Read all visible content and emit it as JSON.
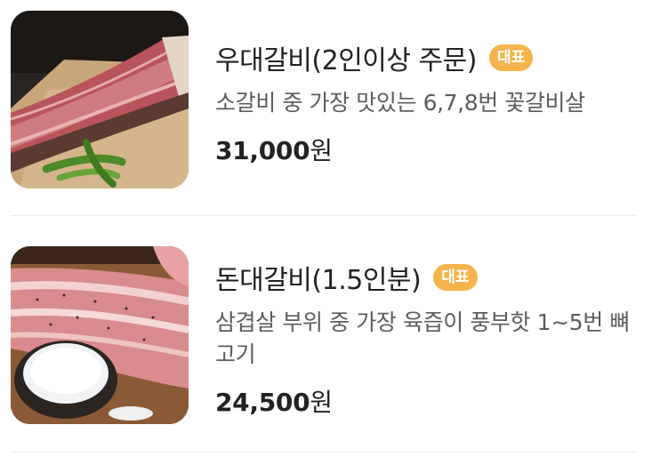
{
  "menu": {
    "items": [
      {
        "name": "우대갈비(2인이상 주문)",
        "badge": "대표",
        "description": "소갈비 중 가장 맛있는 6,7,8번 꽃갈비살",
        "price": "31,000",
        "price_unit": "원",
        "image": "beef-short-rib-photo"
      },
      {
        "name": "돈대갈비(1.5인분)",
        "badge": "대표",
        "description": "삼겹살 부위 중 가장 육즙이 풍부핫 1~5번 뼈고기",
        "price": "24,500",
        "price_unit": "원",
        "image": "pork-rib-with-salt-photo"
      }
    ]
  },
  "colors": {
    "badge": "#f6b44c",
    "title": "#222222",
    "description": "#5c5c5c",
    "divider": "#ececec"
  }
}
